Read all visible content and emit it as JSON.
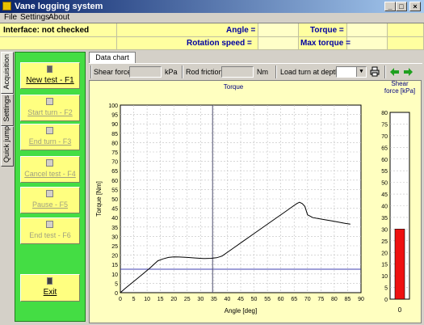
{
  "window": {
    "title": "Vane logging system"
  },
  "menu": [
    "File",
    "Settings",
    "About"
  ],
  "status": {
    "interface": "Interface: not checked",
    "angle_label": "Angle =",
    "torque_label": "Torque =",
    "rotation_label": "Rotation speed =",
    "maxtorque_label": "Max torque ="
  },
  "side_tabs": [
    "Acquisition",
    "Settings",
    "Quick jump"
  ],
  "buttons": {
    "new_test": "New test - F1",
    "start_turn": "Start turn - F2",
    "end_turn": "End turn - F3",
    "cancel_test": "Cancel test - F4",
    "pause": "Pause - F5",
    "end_test": "End test - F6",
    "exit": "Exit"
  },
  "tab": "Data chart",
  "toolbar": {
    "shear_label": "Shear force:",
    "shear_unit": "kPa",
    "rod_label": "Rod friction:",
    "rod_unit": "Nm",
    "load_label": "Load turn at depth:"
  },
  "colors": {
    "status_bg": "#ffffa0",
    "panel": "#44dd44",
    "button": "#ffff80",
    "label": "#0000a0",
    "chart_bg": "#ffffc0",
    "bar": "#ee1111"
  },
  "chart_data": [
    {
      "type": "line",
      "title": "Torque",
      "xlabel": "Angle [deg]",
      "ylabel": "Torque [Nm]",
      "xlim": [
        0,
        90
      ],
      "ylim": [
        0,
        100
      ],
      "xticks": [
        0,
        5,
        10,
        15,
        20,
        25,
        30,
        35,
        40,
        45,
        50,
        55,
        60,
        65,
        70,
        75,
        80,
        85,
        90
      ],
      "yticks": [
        0,
        5,
        10,
        15,
        20,
        25,
        30,
        35,
        40,
        45,
        50,
        55,
        60,
        65,
        70,
        75,
        80,
        85,
        90,
        95,
        100
      ],
      "grid": true,
      "reference_lines": {
        "horizontal_y": 12.5,
        "vertical_x": 34.5
      },
      "x": [
        0,
        2,
        5,
        8,
        11,
        14,
        16,
        18,
        20,
        22,
        25,
        28,
        31,
        34,
        36,
        38,
        42,
        46,
        50,
        54,
        58,
        62,
        64,
        66,
        67,
        68,
        69,
        70,
        72,
        76,
        80,
        84,
        86
      ],
      "y": [
        0,
        2.5,
        6,
        9.5,
        13,
        17,
        18,
        18.8,
        19.1,
        19,
        18.8,
        18.5,
        18.2,
        18.3,
        18.6,
        19.5,
        23.5,
        27.5,
        31.5,
        35.5,
        39.5,
        43.5,
        45.5,
        47.5,
        48.2,
        47.5,
        46,
        41.5,
        40,
        39,
        38,
        37,
        36.5
      ]
    },
    {
      "type": "bar",
      "title": "Shear force [kPa]",
      "categories": [
        ""
      ],
      "values": [
        30
      ],
      "ylim": [
        0,
        80
      ],
      "yticks": [
        0,
        5,
        10,
        15,
        20,
        25,
        30,
        35,
        40,
        45,
        50,
        55,
        60,
        65,
        70,
        75,
        80
      ],
      "xtick_label": "0"
    }
  ]
}
